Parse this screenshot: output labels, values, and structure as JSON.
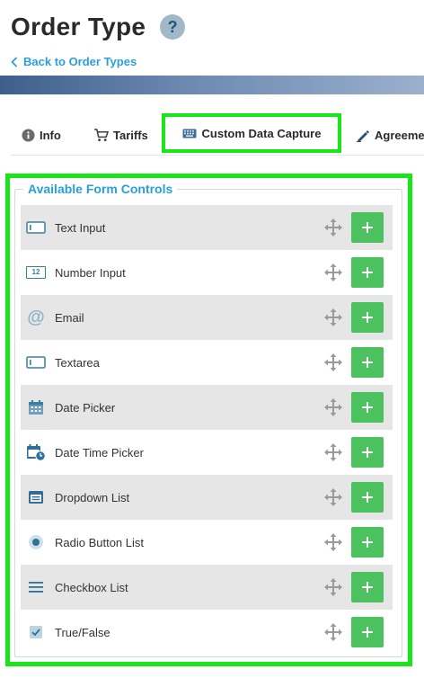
{
  "header": {
    "title": "Order Type",
    "help_glyph": "?",
    "back_label": "Back to Order Types"
  },
  "tabs": [
    {
      "label": "Info",
      "icon": "info-icon"
    },
    {
      "label": "Tariffs",
      "icon": "cart-icon"
    },
    {
      "label": "Custom Data Capture",
      "icon": "keyboard-icon",
      "active": true
    },
    {
      "label": "Agreeme",
      "icon": "pen-icon"
    }
  ],
  "panel": {
    "legend": "Available Form Controls",
    "controls": [
      {
        "label": "Text Input",
        "icon": "text-input-icon"
      },
      {
        "label": "Number Input",
        "icon": "number-input-icon",
        "glyph": "12"
      },
      {
        "label": "Email",
        "icon": "at-icon",
        "glyph": "@"
      },
      {
        "label": "Textarea",
        "icon": "textarea-icon"
      },
      {
        "label": "Date Picker",
        "icon": "calendar-icon"
      },
      {
        "label": "Date Time Picker",
        "icon": "calendar-clock-icon"
      },
      {
        "label": "Dropdown List",
        "icon": "dropdown-icon"
      },
      {
        "label": "Radio Button List",
        "icon": "radio-icon"
      },
      {
        "label": "Checkbox List",
        "icon": "list-icon"
      },
      {
        "label": "True/False",
        "icon": "checkbox-icon"
      }
    ],
    "add_glyph": "+"
  },
  "colors": {
    "accent_blue": "#2b9fd9",
    "add_green": "#4cc25f",
    "highlight_green": "#19e619",
    "icon_blue": "#3b7ea1"
  }
}
